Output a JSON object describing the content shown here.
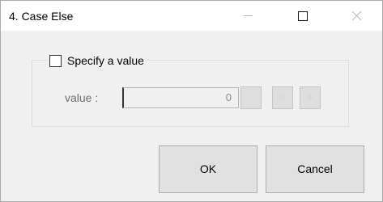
{
  "window": {
    "title": "4. Case Else"
  },
  "titlebar": {
    "minimize_icon": "minimize-icon",
    "maximize_icon": "maximize-icon",
    "close_icon": "close-icon"
  },
  "group": {
    "checkbox_label": "Specify a value",
    "checked": false
  },
  "value_field": {
    "label": "value :",
    "value": "0"
  },
  "small_buttons": [
    {
      "icon": "spin-button"
    },
    {
      "icon": "chevron-left-icon"
    },
    {
      "icon": "chevron-right-icon"
    }
  ],
  "buttons": {
    "ok_label": "OK",
    "cancel_label": "Cancel"
  },
  "colors": {
    "window_bg": "#f0f0f0",
    "titlebar_bg": "#ffffff",
    "button_bg": "#e1e1e1",
    "disabled_text": "#8a8a8a"
  }
}
